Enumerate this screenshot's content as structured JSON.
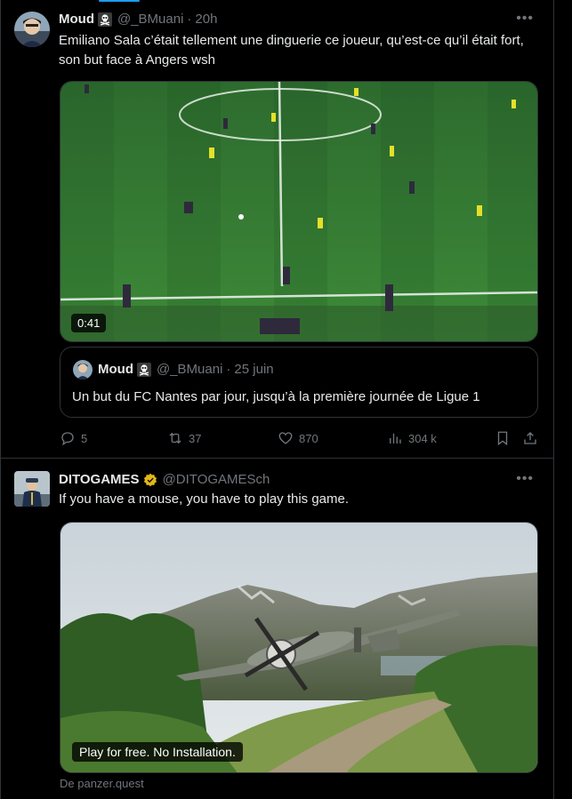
{
  "tweets": [
    {
      "author_name": "Moud",
      "author_badge": "skull-crossbones",
      "handle": "@_BMuani",
      "time": "20h",
      "text": "Emiliano Sala c’était tellement une dinguerie ce joueur, qu’est-ce qu’il était fort, son but face à Angers wsh",
      "video_duration": "0:41",
      "quote": {
        "author_name": "Moud",
        "author_badge": "skull-crossbones",
        "handle": "@_BMuani",
        "time": "25 juin",
        "text": "Un but du FC Nantes par jour, jusqu’à la première journée de Ligue 1"
      },
      "stats": {
        "replies": "5",
        "reposts": "37",
        "likes": "870",
        "views": "304 k"
      }
    },
    {
      "author_name": "DITOGAMES",
      "author_badge": "verified-gold",
      "handle": "@DITOGAMESch",
      "text": "If you have a mouse, you have to play this game.",
      "media_caption": "Play for free. No Installation.",
      "source": "De panzer.quest"
    }
  ],
  "colors": {
    "background": "#000000",
    "text": "#e7e9ea",
    "muted": "#71767b",
    "border": "#2f3336",
    "accent": "#1d9bf0",
    "verified_gold": "#e2b719"
  }
}
